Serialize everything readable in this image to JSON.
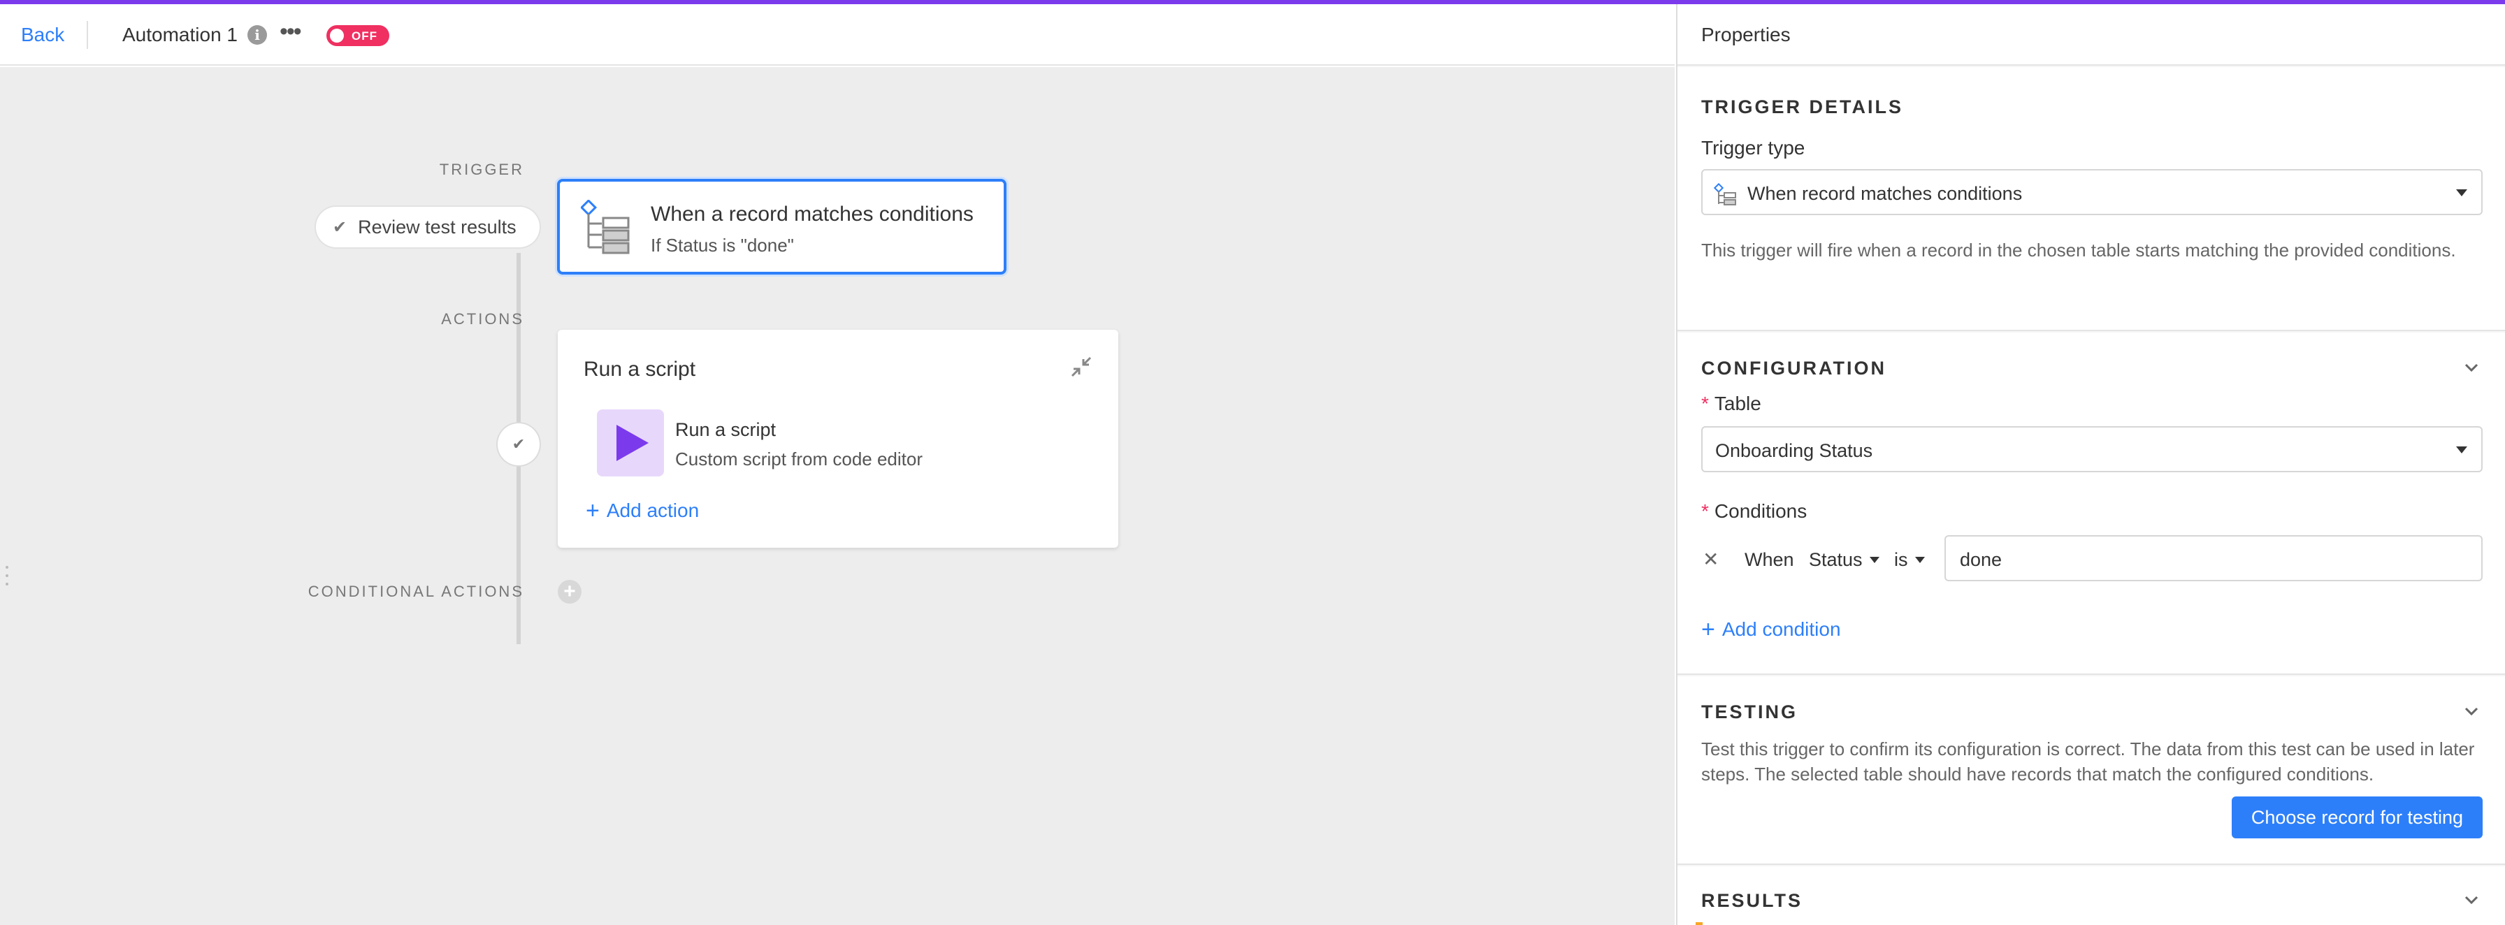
{
  "colors": {
    "accent": "#2d7ff9",
    "brand": "#7c3aed",
    "toggle_off": "#ef3061"
  },
  "header": {
    "back_label": "Back",
    "automation_name": "Automation 1",
    "info_icon": "i",
    "more_icon": "•••",
    "toggle_label": "OFF"
  },
  "canvas": {
    "trigger_label": "TRIGGER",
    "actions_label": "ACTIONS",
    "conditional_actions_label": "CONDITIONAL ACTIONS",
    "review_pill": {
      "check": "✔",
      "label": "Review test results"
    },
    "trigger_card": {
      "title": "When a record matches conditions",
      "subtitle": "If Status is \"done\""
    },
    "action_card": {
      "title": "Run a script",
      "step_title": "Run a script",
      "step_subtitle": "Custom script from code editor",
      "add_action_plus": "+",
      "add_action_label": "Add action"
    },
    "step_check": "✔",
    "add_conditional": "+"
  },
  "panel": {
    "title": "Properties",
    "trigger_details": {
      "title": "TRIGGER DETAILS",
      "type_label": "Trigger type",
      "type_value": "When record matches conditions",
      "description": "This trigger will fire when a record in the chosen table starts matching the provided conditions."
    },
    "configuration": {
      "title": "CONFIGURATION",
      "table_label": "Table",
      "table_value": "Onboarding Status",
      "conditions_label": "Conditions",
      "required_mark": "*",
      "condition": {
        "remove": "✕",
        "when": "When",
        "field": "Status",
        "operator": "is",
        "value": "done"
      },
      "add_condition_plus": "+",
      "add_condition_label": "Add condition"
    },
    "testing": {
      "title": "TESTING",
      "description": "Test this trigger to confirm its configuration is correct. The data from this test can be used in later steps. The selected table should have records that match the configured conditions.",
      "button_label": "Choose record for testing"
    },
    "results": {
      "title": "RESULTS"
    }
  }
}
